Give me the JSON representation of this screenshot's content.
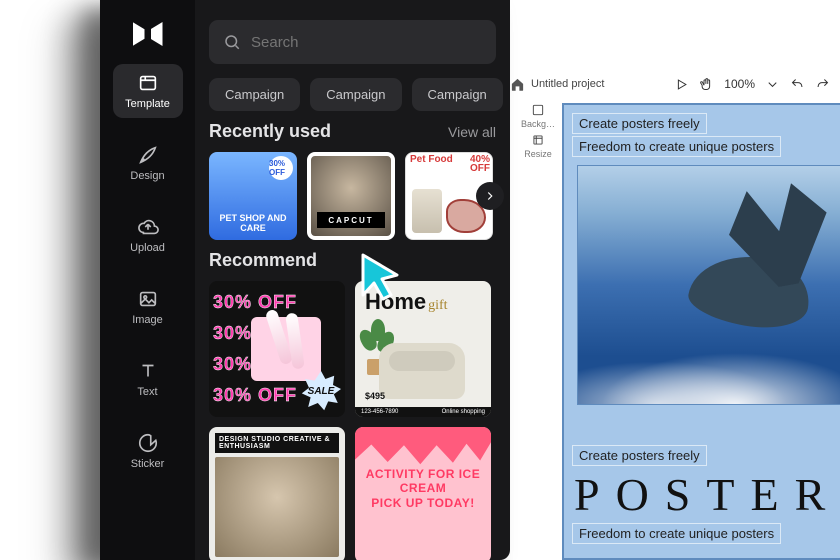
{
  "canvas": {
    "project_name": "Untitled project",
    "zoom": "100%",
    "side_tools": {
      "background": "Backg…",
      "resize": "Resize"
    },
    "poster": {
      "top_line1": "Create posters freely",
      "top_line2": "Freedom to create unique posters",
      "big_title": "POSTER",
      "bottom_line1": "Create posters freely",
      "bottom_line2": "Freedom to create unique posters"
    }
  },
  "rail": {
    "items": [
      {
        "label": "Template"
      },
      {
        "label": "Design"
      },
      {
        "label": "Upload"
      },
      {
        "label": "Image"
      },
      {
        "label": "Text"
      },
      {
        "label": "Sticker"
      }
    ]
  },
  "search": {
    "placeholder": "Search"
  },
  "chips": [
    "Campaign",
    "Campaign",
    "Campaign"
  ],
  "sections": {
    "recent": {
      "title": "Recently used",
      "view_all": "View all"
    },
    "recommend": {
      "title": "Recommend"
    }
  },
  "thumbs": {
    "pet": {
      "badge": "30% OFF",
      "caption": "PET SHOP AND CARE"
    },
    "group": {
      "caption": "CAPCUT"
    },
    "food": {
      "header": "Pet Food",
      "off_top": "40%",
      "off_bot": "OFF"
    },
    "sale30": {
      "stripe": "30% OFF",
      "sale": "SALE"
    },
    "home": {
      "brand": "Home",
      "gift": "gift",
      "price": "$495",
      "foot_left": "123-456-7890",
      "foot_right": "Online shopping"
    },
    "studio": {
      "caption": "DESIGN STUDIO CREATIVE & ENTHUSIASM"
    },
    "ice": {
      "line1": "ACTIVITY FOR ICE CREAM",
      "line2": "PICK UP TODAY!"
    }
  }
}
